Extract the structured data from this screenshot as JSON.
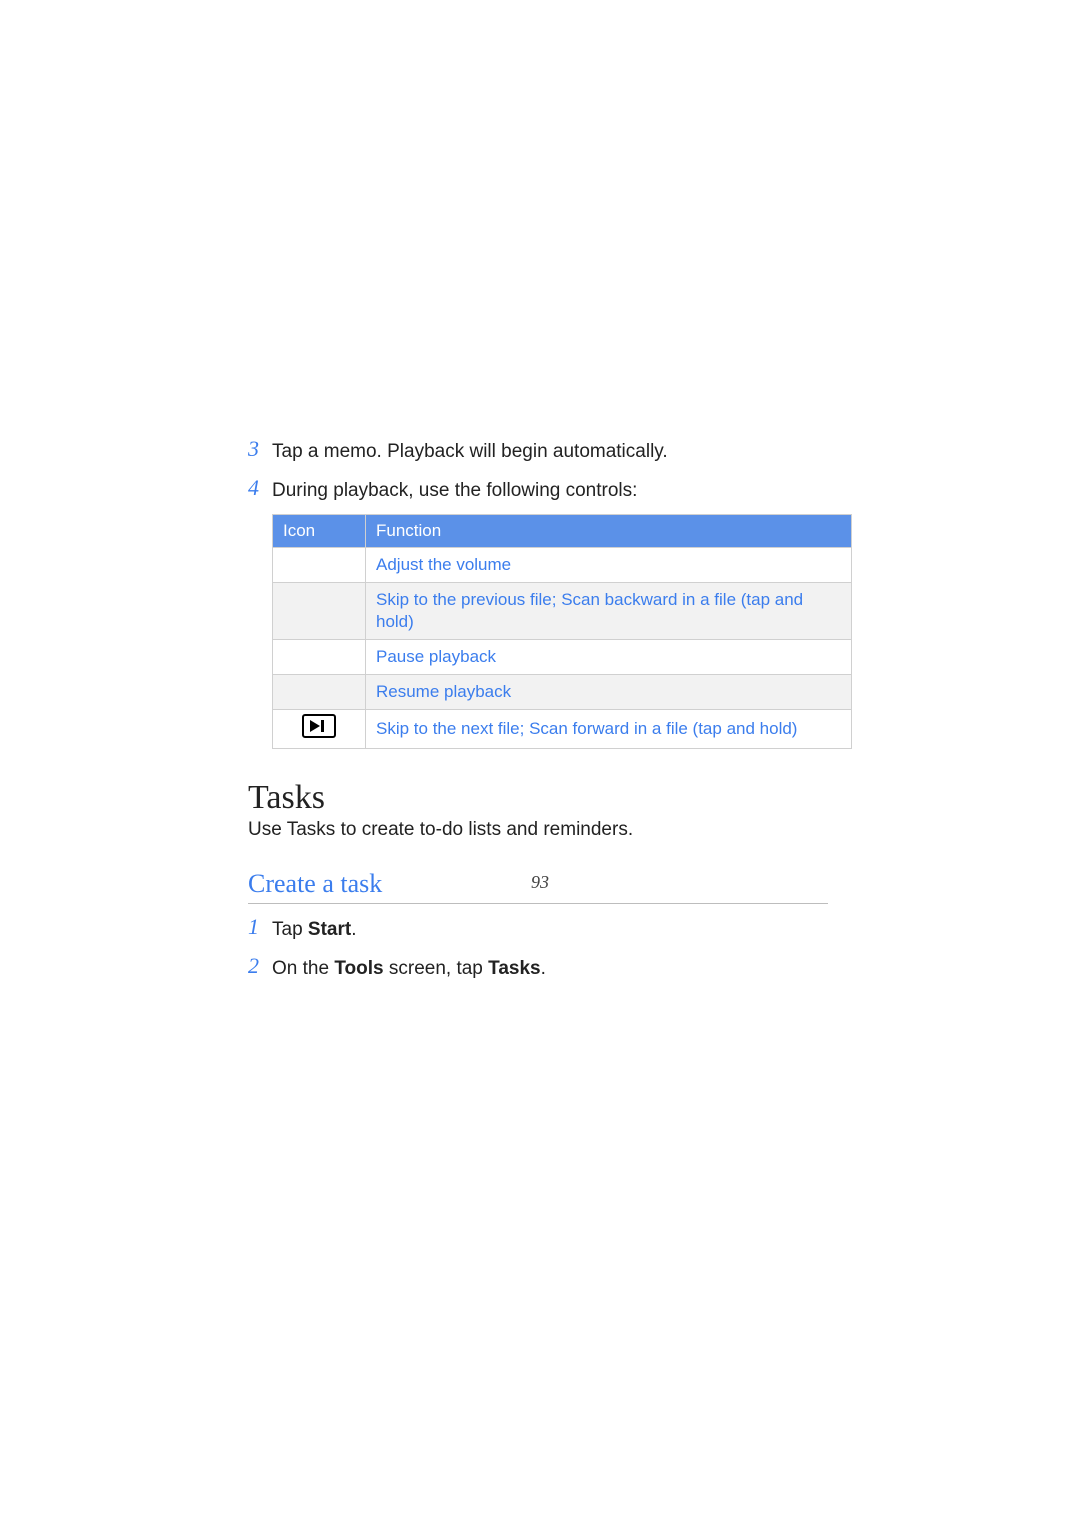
{
  "steps_top": [
    {
      "num": "3",
      "text": "Tap a memo. Playback will begin automatically."
    },
    {
      "num": "4",
      "text": "During playback, use the following controls:"
    }
  ],
  "table": {
    "headers": {
      "icon": "Icon",
      "function": "Function"
    },
    "rows": [
      {
        "icon": "",
        "function": "Adjust the volume",
        "alt": false
      },
      {
        "icon": "",
        "function": "Skip to the previous file; Scan backward in a file (tap and hold)",
        "alt": true
      },
      {
        "icon": "",
        "function": "Pause playback",
        "alt": false
      },
      {
        "icon": "",
        "function": "Resume playback",
        "alt": true
      },
      {
        "icon": "next",
        "function": "Skip to the next file; Scan forward in a file (tap and hold)",
        "alt": false
      }
    ]
  },
  "section": {
    "title": "Tasks",
    "desc": "Use Tasks to create to-do lists and reminders."
  },
  "subsection": {
    "title": "Create a task",
    "steps": [
      {
        "num": "1",
        "prefix": "Tap ",
        "bold": "Start",
        "suffix": "."
      },
      {
        "num": "2",
        "prefix": "On the ",
        "bold": "Tools",
        "mid": " screen, tap ",
        "bold2": "Tasks",
        "suffix": "."
      }
    ]
  },
  "page_number": "93"
}
